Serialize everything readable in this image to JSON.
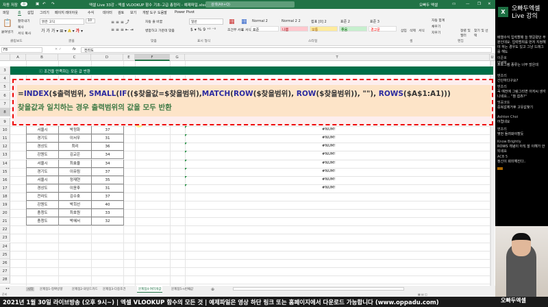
{
  "titlebar": {
    "autosave": "자동 저장",
    "autosave_state": "끔",
    "title": "엑셀 Live 33강 - 엑셀 VLOOKUP 함수 기초-고급 총정리 - 예제파일.xlsx",
    "search": "검색(Alt+Q)",
    "user": "오빠두 엑셀",
    "share": "공유",
    "memo": "메모"
  },
  "menu": [
    "파일",
    "홈",
    "삽입",
    "그리기",
    "페이지 레이아웃",
    "수식",
    "데이터",
    "검토",
    "보기",
    "개발 도구",
    "도움말",
    "Power Pivot"
  ],
  "ribbon": {
    "paste": "붙여넣기",
    "cut": "잘라내기",
    "copy": "복사",
    "format_painter": "서식 복사",
    "clipboard": "클립보드",
    "font_name": "맑은 고딕",
    "font_size": "10",
    "font": "글꼴",
    "wrap": "자동 줄 바꿈",
    "merge": "병합하고 가운데 맞춤",
    "align": "맞춤",
    "number_format": "일반",
    "number": "표시 형식",
    "cond_format": "조건부 서식",
    "table_format": "표 서식",
    "styles_label": "스타일",
    "styles": [
      {
        "top": "Normal 2",
        "bottom": "표준",
        "bg": "#ffffff",
        "fg": "#222222"
      },
      {
        "top": "Normal 2 2",
        "bottom": "나쁨",
        "bg": "#ffc7ce",
        "fg": "#9c0006"
      },
      {
        "top": "쉼표 [0] 2",
        "bottom": "보통",
        "bg": "#ffeb9c",
        "fg": "#9c5700"
      },
      {
        "top": "표준 2",
        "bottom": "좋음",
        "bg": "#c6efce",
        "fg": "#006100"
      },
      {
        "top": "표준 3",
        "bottom": "경고문",
        "bg": "#ffffff",
        "fg": "#ff0000"
      }
    ],
    "insert": "삽입",
    "delete": "삭제",
    "format": "서식",
    "cells": "셀",
    "autosum": "자동 합계",
    "fill": "채우기",
    "clear": "지우기",
    "sort": "정렬 및 필터",
    "find": "찾기 및 선택",
    "editing": "편집"
  },
  "formula_bar": {
    "name_box": "F8",
    "fx": "fx",
    "value": "전라도"
  },
  "columns": [
    "A",
    "B",
    "C",
    "D",
    "E",
    "F",
    "G",
    "T",
    "U"
  ],
  "rows": [
    "3",
    "4",
    "5",
    "6",
    "7",
    "8",
    "9",
    "10",
    "11",
    "12",
    "13",
    "14",
    "15",
    "16",
    "17",
    "18",
    "19",
    "20",
    "21",
    "22",
    "23",
    "24",
    "25",
    "26",
    "27",
    "28"
  ],
  "band": {
    "icon": "info-icon",
    "text": "조건을 만족하는 모든 값 반환"
  },
  "overlay": {
    "formula_parts": [
      {
        "t": "=",
        "fn": false
      },
      {
        "t": "INDEX",
        "fn": true
      },
      {
        "t": "($출력범위, ",
        "fn": false
      },
      {
        "t": "SMALL",
        "fn": true
      },
      {
        "t": "(",
        "fn": false
      },
      {
        "t": "IF",
        "fn": true
      },
      {
        "t": "(($찾을값=$찾을범위),",
        "fn": false
      },
      {
        "t": "MATCH",
        "fn": true
      },
      {
        "t": "(",
        "fn": false
      },
      {
        "t": "ROW",
        "fn": true
      },
      {
        "t": "($찾을범위), ",
        "fn": false
      },
      {
        "t": "ROW",
        "fn": true
      },
      {
        "t": "($찾을범위)), \"\"), ",
        "fn": false
      },
      {
        "t": "ROWS",
        "fn": true
      },
      {
        "t": "($A$1:A1)))",
        "fn": false
      }
    ],
    "description": "찾을값과 일치하는 경우 출력범위의 값을 모두 반환"
  },
  "table": [
    [
      "서울시",
      "박정화",
      "37"
    ],
    [
      "경기도",
      "이서우",
      "31"
    ],
    [
      "경상도",
      "최리",
      "36"
    ],
    [
      "강원도",
      "김교은",
      "34"
    ],
    [
      "서울시",
      "최효율",
      "34"
    ],
    [
      "경기도",
      "이유림",
      "37"
    ],
    [
      "서울시",
      "정재현",
      "35"
    ],
    [
      "경상도",
      "이윤후",
      "31"
    ],
    [
      "전라도",
      "김수호",
      "37"
    ],
    [
      "강원도",
      "박희선",
      "40"
    ],
    [
      "충청도",
      "최호원",
      "33"
    ],
    [
      "충청도",
      "박혜서",
      "32"
    ]
  ],
  "errors": [
    "#NUM!",
    "#NUM!",
    "#NUM!",
    "#NUM!",
    "#NUM!",
    "#NUM!",
    "#NUM!",
    "#NUM!"
  ],
  "sheet_tabs": [
    "시작",
    "문제점1-정확방향",
    "문제점2-와일드카드",
    "문제점3-다중조건",
    "문제점4-여러개값",
    "문제점5-n번째값"
  ],
  "active_tab": 4,
  "status": "준비",
  "banner": "2021년 1월 30일 라이브방송 (오후 9시~) | 엑셀 VLOOKUP 함수의 모든 것 | 예제파일은 영상 하단 링크 또는 홈페이지에서 다운로드 가능합니다 (www.oppadu.com)",
  "side": {
    "brand1": "오빠두엑셀",
    "brand2": "Live 강의",
    "logo": "X",
    "chat": [
      {
        "u": "",
        "m": "배열수식 입력할때 늘 헷갈렸던 부분인데요. 입력범위를 먼저 지정해야 하는 경우도 있고 그냥 드래그를 해도"
      },
      {
        "u": "이준호",
        "m": "안녕하"
      },
      {
        "u": "",
        "m": "프로그램 종류는 너무 많은데"
      },
      {
        "u": "멘초리",
        "m": "간단하다구요?"
      },
      {
        "u": "멘초리",
        "m": "꼭 예전에 그림그리면 아저씨 생각 나네요... \"참 쉽죠?\""
      },
      {
        "u": "맹꽁코또",
        "m": "중복값제거후 고유값찾기"
      },
      {
        "u": "Ashton Choi",
        "m": "어렵네요"
      },
      {
        "u": "멘초리",
        "m": "몇번 돌려봐야할듯"
      },
      {
        "u": "Know Brightly",
        "m": "ROWS 개념이 아직 잘 이해가 안되네요"
      },
      {
        "u": "ACB 5",
        "m": "정신이 희미해진다.."
      }
    ],
    "cam_logo": "오빠두엑셀"
  }
}
